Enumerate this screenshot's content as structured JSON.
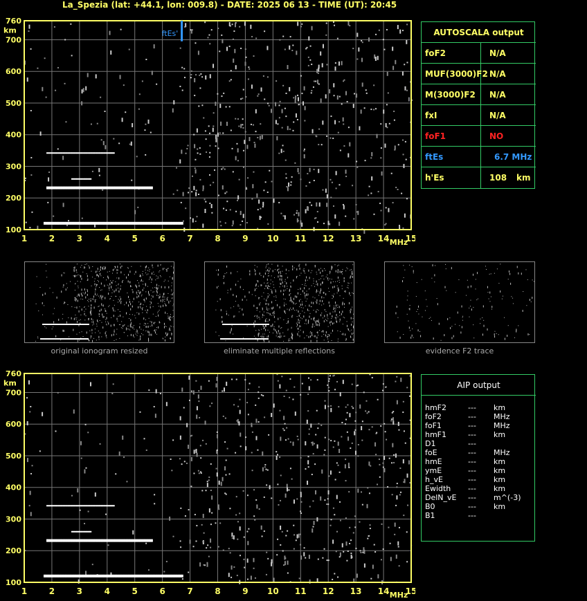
{
  "title": "La_Spezia (lat: +44.1, lon: 009.8) - DATE: 2025 06 13 - TIME (UT): 20:45",
  "colors": {
    "axis": "#ffff66",
    "grid": "#777777",
    "panel": "#33cc66",
    "fEs": "#3399ff",
    "foF1": "#ff2222"
  },
  "chart_data": [
    {
      "type": "scatter",
      "name": "ionogram",
      "xlabel": "MHz",
      "ylabel": "km",
      "xlim": [
        1,
        15
      ],
      "ylim": [
        100,
        760
      ],
      "xticks": [
        "1",
        "2",
        "3",
        "4",
        "5",
        "6",
        "7",
        "8",
        "9",
        "10",
        "11",
        "12",
        "13",
        "14",
        "15"
      ],
      "yticks": [
        "100",
        "200",
        "300",
        "400",
        "500",
        "600",
        "700",
        "760"
      ],
      "grid": true,
      "traces": [
        {
          "x_from": 1.7,
          "x_to": 6.7,
          "y": 120
        },
        {
          "x_from": 1.8,
          "x_to": 5.6,
          "y": 232
        },
        {
          "x_from": 2.7,
          "x_to": 3.4,
          "y": 260
        },
        {
          "x_from": 1.8,
          "x_to": 4.2,
          "y": 342
        }
      ],
      "annotation": {
        "label": "ftEs'",
        "x": 6.7,
        "y_from": 695,
        "y_to": 760
      }
    },
    {
      "type": "scatter",
      "name": "ionogram-aip",
      "xlabel": "MHz",
      "ylabel": "km",
      "xlim": [
        1,
        15
      ],
      "ylim": [
        100,
        760
      ],
      "xticks": [
        "1",
        "2",
        "3",
        "4",
        "5",
        "6",
        "7",
        "8",
        "9",
        "10",
        "11",
        "12",
        "13",
        "14",
        "15"
      ],
      "yticks": [
        "100",
        "200",
        "300",
        "400",
        "500",
        "600",
        "700",
        "760"
      ],
      "grid": true
    }
  ],
  "autoscala": {
    "header": "AUTOSCALA output",
    "rows": [
      {
        "key": "foF2",
        "value": "N/A",
        "color": "#ffff66"
      },
      {
        "key": "MUF(3000)F2",
        "value": "N/A",
        "color": "#ffff66"
      },
      {
        "key": "M(3000)F2",
        "value": "N/A",
        "color": "#ffff66"
      },
      {
        "key": "fxI",
        "value": "N/A",
        "color": "#ffff66"
      },
      {
        "key": "foF1",
        "value": "NO",
        "color": "#ff2222"
      },
      {
        "key": "ftEs",
        "value": "6.7 MHz",
        "color": "#3399ff"
      },
      {
        "key": "h'Es",
        "value": "108",
        "unit": "km",
        "color": "#ffff66"
      }
    ]
  },
  "thumbnails": [
    {
      "caption": "original ionogram resized"
    },
    {
      "caption": "eliminate multiple reflections"
    },
    {
      "caption": "evidence F2 trace"
    }
  ],
  "aip": {
    "header": "AIP output",
    "rows": [
      {
        "param": "hmF2",
        "value": "---",
        "unit": "km"
      },
      {
        "param": "foF2",
        "value": "---",
        "unit": "MHz"
      },
      {
        "param": "foF1",
        "value": "---",
        "unit": "MHz"
      },
      {
        "param": "hmF1",
        "value": "---",
        "unit": "km"
      },
      {
        "param": "D1",
        "value": "---",
        "unit": ""
      },
      {
        "param": "foE",
        "value": "---",
        "unit": "MHz"
      },
      {
        "param": "hmE",
        "value": "---",
        "unit": "km"
      },
      {
        "param": "ymE",
        "value": "---",
        "unit": "km"
      },
      {
        "param": "h_vE",
        "value": "---",
        "unit": "km"
      },
      {
        "param": "Ewidth",
        "value": "---",
        "unit": "km"
      },
      {
        "param": "DelN_vE",
        "value": "---",
        "unit": "m^(-3)"
      },
      {
        "param": "B0",
        "value": "---",
        "unit": "km"
      },
      {
        "param": "B1",
        "value": "---",
        "unit": ""
      }
    ]
  }
}
